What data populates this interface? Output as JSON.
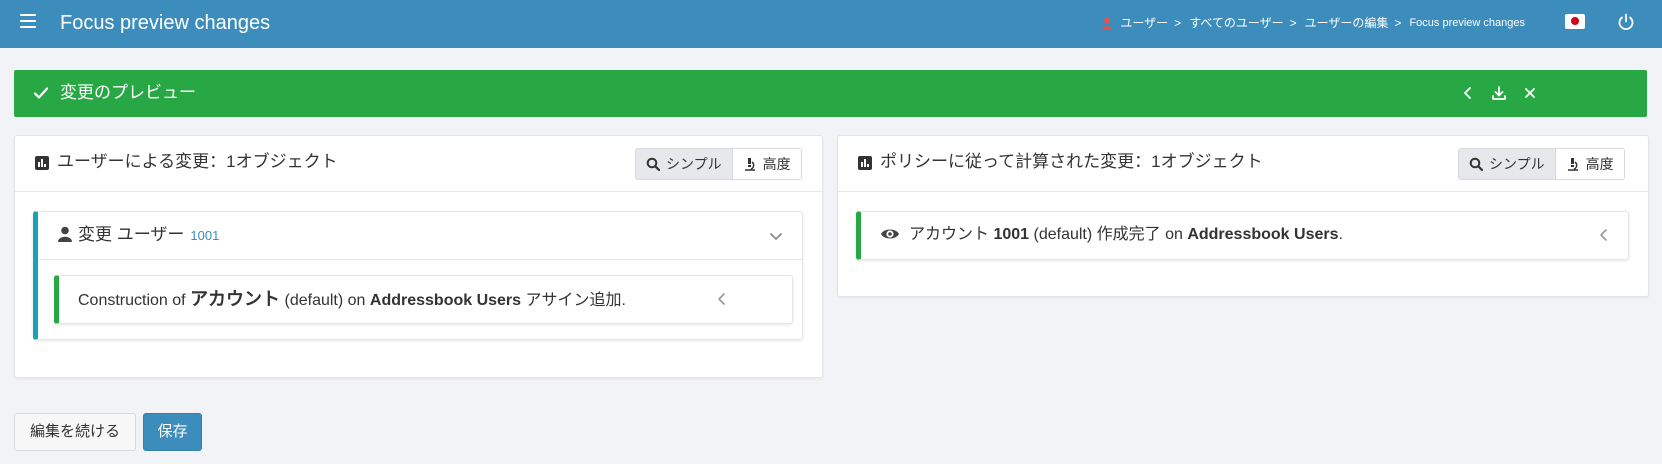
{
  "header": {
    "title": "Focus preview changes",
    "breadcrumbs": [
      "ユーザー",
      "すべてのユーザー",
      "ユーザーの編集"
    ],
    "breadcrumb_separator": ">",
    "breadcrumb_current": "Focus preview changes",
    "icons": [
      "menu-icon",
      "user-icon",
      "japan-flag-icon",
      "power-icon"
    ]
  },
  "banner": {
    "title": "変更のプレビュー",
    "color": "#28a745",
    "icons": [
      "check-icon",
      "chevron-left-icon",
      "download-icon",
      "close-icon"
    ]
  },
  "left_panel": {
    "title": "ユーザーによる変更：1オブジェクト",
    "view_toggle": {
      "simple": "シンプル",
      "advanced": "高度",
      "selected": "シンプル"
    },
    "object": {
      "label": "変更 ユーザー",
      "id_link": "1001",
      "change": {
        "prefix": "Construction of ",
        "account": "アカウント",
        "middle": " (default) on ",
        "resource": "Addressbook Users",
        "suffix": " アサイン追加."
      }
    }
  },
  "right_panel": {
    "title": "ポリシーに従って計算された変更：1オブジェクト",
    "view_toggle": {
      "simple": "シンプル",
      "advanced": "高度",
      "selected": "シンプル"
    },
    "change": {
      "prefix": "アカウント ",
      "id": "1001",
      "middle": " (default) 作成完了 on ",
      "resource": "Addressbook Users",
      "suffix": "."
    }
  },
  "actions": {
    "continue_editing": "編集を続ける",
    "save": "保存"
  },
  "colors": {
    "header": "#3c8dbc",
    "banner": "#28a745",
    "teal_accent": "#17a2b8",
    "primary": "#3c8dbc",
    "background": "#f1f3f7"
  }
}
